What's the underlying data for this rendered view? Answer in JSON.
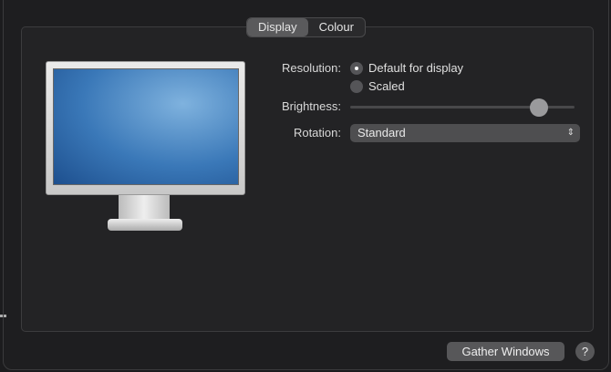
{
  "tabs": [
    {
      "label": "Display",
      "selected": true
    },
    {
      "label": "Colour",
      "selected": false
    }
  ],
  "resolution": {
    "label": "Resolution:",
    "options": [
      {
        "label": "Default for display",
        "selected": true
      },
      {
        "label": "Scaled",
        "selected": false
      }
    ]
  },
  "brightness": {
    "label": "Brightness:",
    "value": 0.84
  },
  "rotation": {
    "label": "Rotation:",
    "value": "Standard"
  },
  "footer": {
    "gather": "Gather Windows",
    "help": "?"
  }
}
